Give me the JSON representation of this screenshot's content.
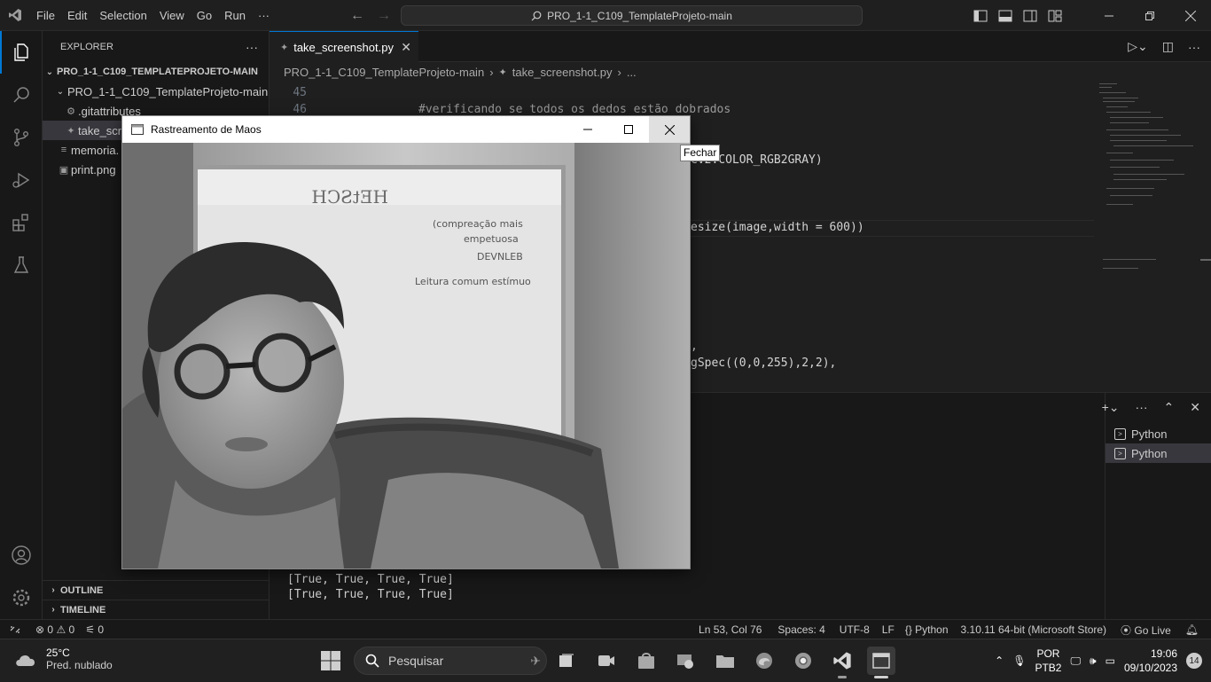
{
  "titlebar": {
    "menus": [
      "File",
      "Edit",
      "Selection",
      "View",
      "Go",
      "Run",
      "···"
    ],
    "search": "PRO_1-1_C109_TemplateProjeto-main"
  },
  "explorer": {
    "title": "EXPLORER",
    "more": "···",
    "root": "PRO_1-1_C109_TEMPLATEPROJETO-MAIN",
    "folder": "PRO_1-1_C109_TemplateProjeto-main",
    "files": [
      ".gitattributes",
      "take_scre",
      "memoria.",
      "print.png"
    ],
    "outline": "OUTLINE",
    "timeline": "TIMELINE"
  },
  "editor": {
    "tab": "take_screenshot.py",
    "breadcrumb": {
      "folder": "PRO_1-1_C109_TemplateProjeto-main",
      "file": "take_screenshot.py",
      "more": "..."
    },
    "lines": [
      {
        "num": "45",
        "text": ""
      },
      {
        "num": "46",
        "text": "#verificando se todos os dedos estão dobrados"
      }
    ],
    "fragments": [
      "cv2.COLOR_RGB2GRAY)",
      "esize(image,width = 600))",
      ",",
      "gSpec((0,0,255),2,2),"
    ]
  },
  "terminal": {
    "output": [
      "[True, True, True, True]",
      "[True, True, True, True]"
    ],
    "instances": [
      "Python",
      "Python"
    ]
  },
  "statusbar": {
    "errors": "0",
    "warnings": "0",
    "ports": "0",
    "position": "Ln 53, Col 76",
    "spaces": "Spaces: 4",
    "encoding": "UTF-8",
    "eol": "LF",
    "language": "Python",
    "interpreter": "3.10.11 64-bit (Microsoft Store)",
    "golive": "Go Live"
  },
  "cv_window": {
    "title": "Rastreamento de Maos",
    "tooltip": "Fechar",
    "whiteboard_text": [
      "HEtSCH",
      "(compreação mais",
      "empetuosa",
      "DEVNLEB",
      "Leitura comum estímuo"
    ]
  },
  "taskbar": {
    "temperature": "25°C",
    "weather": "Pred. nublado",
    "search_placeholder": "Pesquisar",
    "lang1": "POR",
    "lang2": "PTB2",
    "time": "19:06",
    "date": "09/10/2023",
    "notifications": "14"
  }
}
